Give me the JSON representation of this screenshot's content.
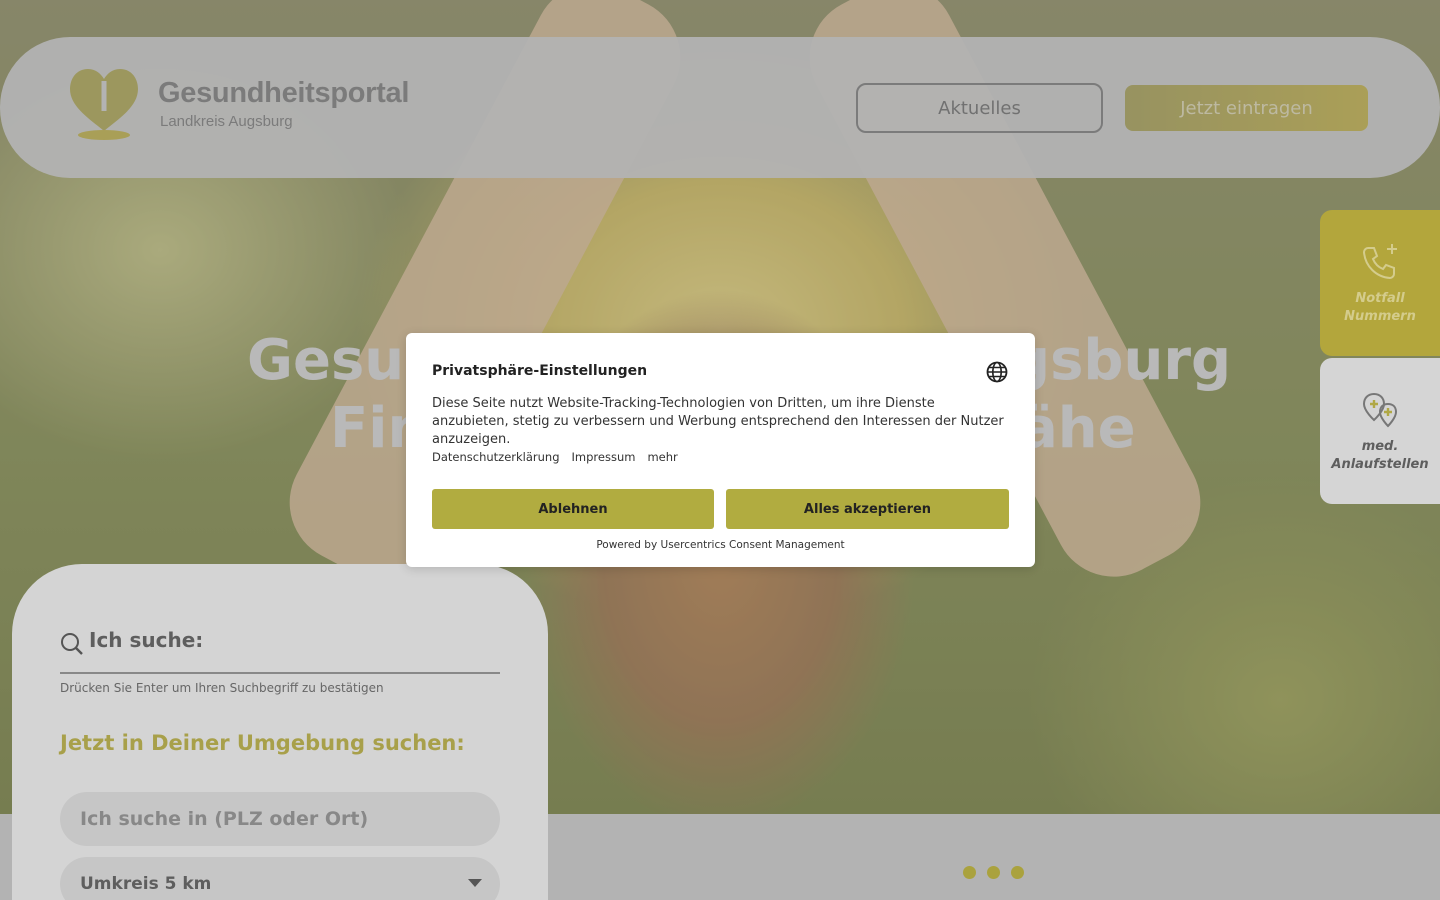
{
  "header": {
    "brand_title": "Gesundheitsportal",
    "brand_subtitle": "Landkreis Augsburg",
    "nav_aktuelles": "Aktuelles",
    "nav_eintragen": "Jetzt eintragen"
  },
  "hero": {
    "line1_left": "Gesun",
    "line1_right": "gsburg",
    "line2_left": "Fin",
    "line2_right": "ähe"
  },
  "side_tabs": {
    "notfall_line1": "Notfall",
    "notfall_line2": "Nummern",
    "med_line1": "med.",
    "med_line2": "Anlaufstellen"
  },
  "search": {
    "label": "Ich suche:",
    "hint": "Drücken Sie Enter um Ihren Suchbegriff zu bestätigen",
    "near_title": "Jetzt in Deiner Umgebung suchen:",
    "plz_placeholder": "Ich suche in (PLZ oder Ort)",
    "radius_value": "Umkreis 5 km"
  },
  "consent": {
    "title": "Privatsphäre-Einstellungen",
    "text": "Diese Seite nutzt Website-Tracking-Technologien von Dritten, um ihre Dienste anzubieten, stetig zu verbessern und Werbung entsprechend den Interessen der Nutzer anzuzeigen.",
    "link_privacy": "Datenschutzerklärung",
    "link_imprint": "Impressum",
    "link_more": "mehr",
    "deny_label": "Ablehnen",
    "accept_label": "Alles akzeptieren",
    "powered_by": "Powered by Usercentrics Consent Management"
  },
  "icons": {
    "logo": "heart-pin-logo",
    "emergency": "phone-plus-icon",
    "medical": "map-pins-icon",
    "search": "search-icon",
    "language": "globe-icon",
    "dropdown": "chevron-down-icon"
  },
  "colors": {
    "accent": "#b1ac40",
    "accent_text": "#a8a04a"
  },
  "pagination": {
    "dots": 3,
    "active": 1
  }
}
